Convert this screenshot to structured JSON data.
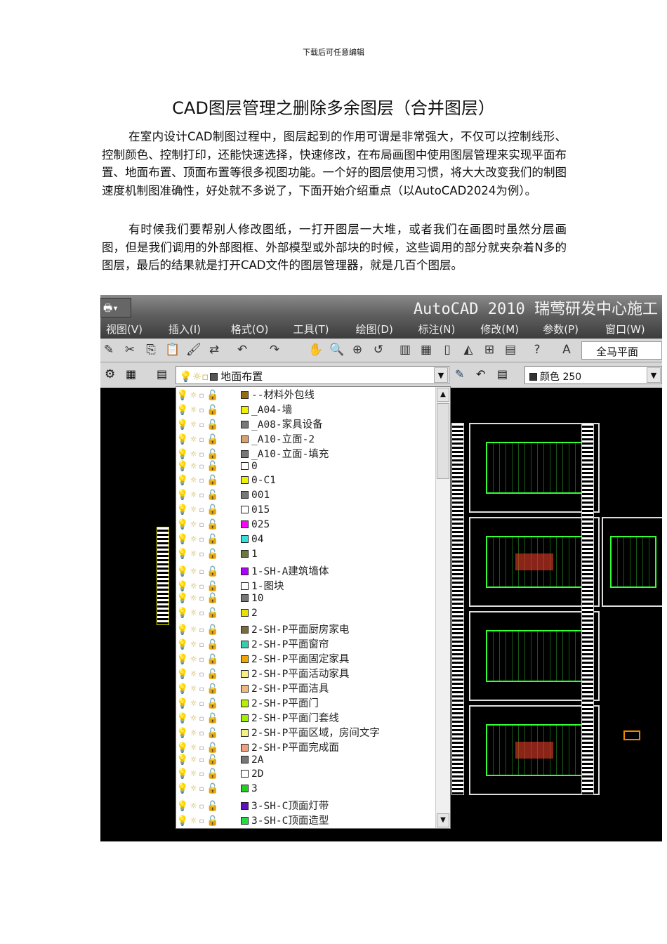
{
  "header_note": "下载后可任意编辑",
  "title": "CAD图层管理之删除多余图层（合并图层）",
  "paragraphs": [
    "在室内设计CAD制图过程中，图层起到的作用可谓是非常强大，不仅可以控制线形、控制颜色、控制打印，还能快速选择，快速修改，在布局画图中使用图层管理来实现平面布置、地面布置、顶面布置等很多视图功能。一个好的图层使用习惯，将大大改变我们的制图速度机制图准确性，好处就不多说了，下面开始介绍重点（以AutoCAD2024为例）。",
    "有时候我们要帮别人修改图纸，一打开图层一大堆，或者我们在画图时虽然分层画图，但是我们调用的外部图框、外部模型或外部块的时候，这些调用的部分就夹杂着N多的图层，最后的结果就是打开CAD文件的图层管理器，就是几百个图层。"
  ],
  "screenshot": {
    "app_title": "AutoCAD 2010  瑞莺研发中心施工",
    "menu": [
      "视图(V)",
      "插入(I)",
      "格式(O)",
      "工具(T)",
      "绘图(D)",
      "标注(N)",
      "修改(M)",
      "参数(P)",
      "窗口(W)"
    ],
    "text_style": "全马平面",
    "current_layer": {
      "name": "地面布置",
      "color": "#555555"
    },
    "color_control": {
      "label": "颜色 250",
      "color": "#333333"
    },
    "layers": [
      {
        "name": "--材料外包线",
        "color": "#9a6a10"
      },
      {
        "name": "_A04-墙",
        "color": "#f0f000"
      },
      {
        "name": "_A08-家具设备",
        "color": "#777777"
      },
      {
        "name": "_A10-立面-2",
        "color": "#d9a070"
      },
      {
        "name": "_A10-立面-填充",
        "color": "#777777"
      },
      {
        "name": "0",
        "color": "#ffffff"
      },
      {
        "name": "0-C1",
        "color": "#f0f000"
      },
      {
        "name": "001",
        "color": "#777777"
      },
      {
        "name": "015",
        "color": "#ffffff"
      },
      {
        "name": "025",
        "color": "#ff00ff"
      },
      {
        "name": "04",
        "color": "#33e0e0"
      },
      {
        "name": "1",
        "color": "#6a7a3a"
      },
      {
        "name": "1-SH-A建筑墙体",
        "color": "#b000ff"
      },
      {
        "name": "1-图块",
        "color": "#ffffff"
      },
      {
        "name": "10",
        "color": "#777777"
      },
      {
        "name": "2",
        "color": "#e8e000"
      },
      {
        "name": "2-SH-P平面厨房家电",
        "color": "#7a6a40"
      },
      {
        "name": "2-SH-P平面窗帘",
        "color": "#30d0b0"
      },
      {
        "name": "2-SH-P平面固定家具",
        "color": "#f0a800"
      },
      {
        "name": "2-SH-P平面活动家具",
        "color": "#f5f080"
      },
      {
        "name": "2-SH-P平面洁具",
        "color": "#f0b880"
      },
      {
        "name": "2-SH-P平面门",
        "color": "#b8f000"
      },
      {
        "name": "2-SH-P平面门套线",
        "color": "#a0f000"
      },
      {
        "name": "2-SH-P平面区域，房间文字",
        "color": "#f5f080"
      },
      {
        "name": "2-SH-P平面完成面",
        "color": "#f0a080"
      },
      {
        "name": "2A",
        "color": "#777777"
      },
      {
        "name": "2D",
        "color": "#ffffff"
      },
      {
        "name": "3",
        "color": "#20d020"
      },
      {
        "name": "3-SH-C顶面灯带",
        "color": "#6010c0"
      },
      {
        "name": "3-SH-C顶面造型",
        "color": "#20e040"
      }
    ]
  }
}
